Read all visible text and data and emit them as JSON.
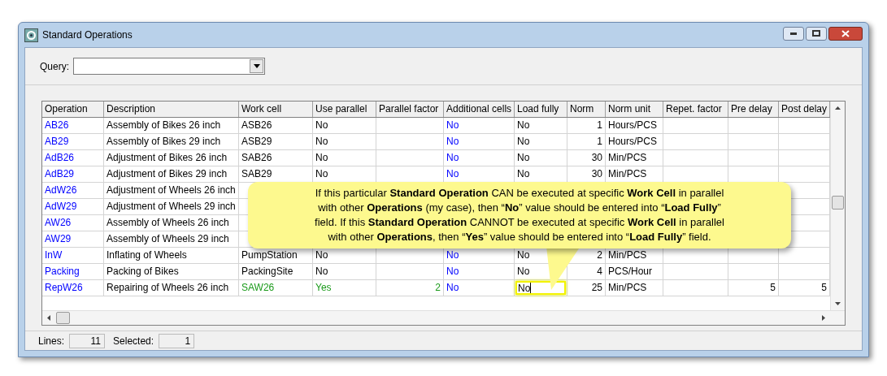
{
  "window": {
    "title": "Standard Operations"
  },
  "query": {
    "label": "Query:"
  },
  "table": {
    "columns": [
      "Operation",
      "Description",
      "Work cell",
      "Use parallel",
      "Parallel factor",
      "Additional cells",
      "Load fully",
      "Norm",
      "Norm unit",
      "Repet. factor",
      "Pre delay",
      "Post delay"
    ],
    "rows": [
      {
        "operation": "AB26",
        "description": "Assembly of Bikes 26 inch",
        "work_cell": "ASB26",
        "use_parallel": "No",
        "additional_cells": "No",
        "load_fully": "No",
        "norm": "1",
        "norm_unit": "Hours/PCS",
        "parallel": false,
        "editing": false
      },
      {
        "operation": "AB29",
        "description": "Assembly of Bikes 29 inch",
        "work_cell": "ASB29",
        "use_parallel": "No",
        "additional_cells": "No",
        "load_fully": "No",
        "norm": "1",
        "norm_unit": "Hours/PCS",
        "parallel": false,
        "editing": false
      },
      {
        "operation": "AdB26",
        "description": "Adjustment of Bikes 26 inch",
        "work_cell": "SAB26",
        "use_parallel": "No",
        "additional_cells": "No",
        "load_fully": "No",
        "norm": "30",
        "norm_unit": "Min/PCS",
        "parallel": false,
        "editing": false
      },
      {
        "operation": "AdB29",
        "description": "Adjustment of Bikes 29 inch",
        "work_cell": "SAB29",
        "use_parallel": "No",
        "additional_cells": "No",
        "load_fully": "No",
        "norm": "30",
        "norm_unit": "Min/PCS",
        "parallel": false,
        "editing": false
      },
      {
        "operation": "AdW26",
        "description": "Adjustment of Wheels 26 inch"
      },
      {
        "operation": "AdW29",
        "description": "Adjustment of Wheels 29 inch"
      },
      {
        "operation": "AW26",
        "description": "Assembly of Wheels 26 inch"
      },
      {
        "operation": "AW29",
        "description": "Assembly of Wheels 29 inch"
      },
      {
        "operation": "InW",
        "description": "Inflating of Wheels",
        "work_cell": "PumpStation",
        "use_parallel": "No",
        "additional_cells": "No",
        "load_fully": "No",
        "norm": "2",
        "norm_unit": "Min/PCS",
        "parallel": false,
        "editing": false
      },
      {
        "operation": "Packing",
        "description": "Packing of Bikes",
        "work_cell": "PackingSite",
        "use_parallel": "No",
        "additional_cells": "No",
        "load_fully": "No",
        "norm": "4",
        "norm_unit": "PCS/Hour",
        "parallel": false,
        "editing": false
      },
      {
        "operation": "RepW26",
        "description": "Repairing of Wheels 26 inch",
        "work_cell": "SAW26",
        "use_parallel": "Yes",
        "parallel_factor": "2",
        "additional_cells": "No",
        "load_fully": "No",
        "norm": "25",
        "norm_unit": "Min/PCS",
        "pre_delay": "5",
        "post_delay": "5",
        "parallel": true,
        "editing": true
      }
    ]
  },
  "callout": {
    "lines": [
      "If this particular **Standard Operation** CAN be executed at specific **Work Cell** in parallel",
      "with other **Operations** (my case), then “**No**” value should be entered into “**Load Fully**”",
      "field.  If this **Standard Operation** CANNOT be executed at specific **Work Cell** in parallel",
      "with other **Operations**, then “**Yes**” value should be entered into “**Load Fully**” field."
    ]
  },
  "status_bar": {
    "lines_label": "Lines:",
    "lines": "11",
    "selected_label": "Selected:",
    "selected": "1"
  }
}
